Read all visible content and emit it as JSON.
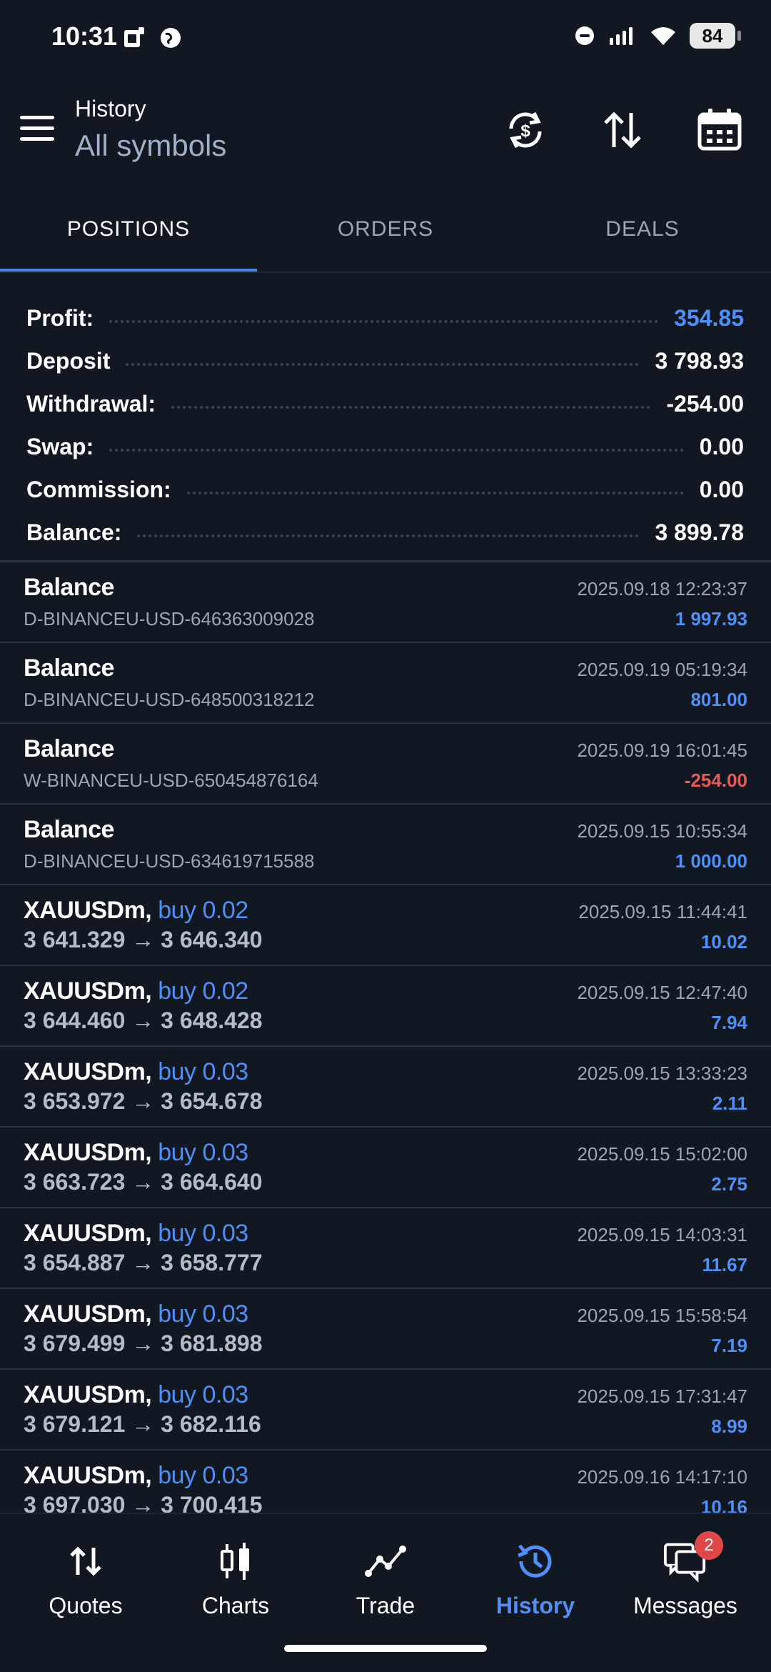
{
  "status_bar": {
    "time": "10:31",
    "battery": "84"
  },
  "header": {
    "title": "History",
    "subtitle": "All symbols"
  },
  "tabs": [
    {
      "label": "POSITIONS",
      "active": true
    },
    {
      "label": "ORDERS",
      "active": false
    },
    {
      "label": "DEALS",
      "active": false
    }
  ],
  "summary": [
    {
      "label": "Profit:",
      "value": "354.85",
      "highlight": true
    },
    {
      "label": "Deposit",
      "value": "3 798.93"
    },
    {
      "label": "Withdrawal:",
      "value": "-254.00"
    },
    {
      "label": "Swap:",
      "value": "0.00"
    },
    {
      "label": "Commission:",
      "value": "0.00"
    },
    {
      "label": "Balance:",
      "value": "3 899.78"
    }
  ],
  "balance_rows": [
    {
      "title": "Balance",
      "sub": "D-BINANCEU-USD-646363009028",
      "time": "2025.09.18 12:23:37",
      "amount": "1 997.93"
    },
    {
      "title": "Balance",
      "sub": "D-BINANCEU-USD-648500318212",
      "time": "2025.09.19 05:19:34",
      "amount": "801.00"
    },
    {
      "title": "Balance",
      "sub": "W-BINANCEU-USD-650454876164",
      "time": "2025.09.19 16:01:45",
      "amount": "-254.00"
    },
    {
      "title": "Balance",
      "sub": "D-BINANCEU-USD-634619715588",
      "time": "2025.09.15 10:55:34",
      "amount": "1 000.00"
    }
  ],
  "trade_rows": [
    {
      "symbol": "XAUUSDm,",
      "side": "buy 0.02",
      "prices": "3 641.329 → 3 646.340",
      "time": "2025.09.15 11:44:41",
      "amount": "10.02"
    },
    {
      "symbol": "XAUUSDm,",
      "side": "buy 0.02",
      "prices": "3 644.460 → 3 648.428",
      "time": "2025.09.15 12:47:40",
      "amount": "7.94"
    },
    {
      "symbol": "XAUUSDm,",
      "side": "buy 0.03",
      "prices": "3 653.972 → 3 654.678",
      "time": "2025.09.15 13:33:23",
      "amount": "2.11"
    },
    {
      "symbol": "XAUUSDm,",
      "side": "buy 0.03",
      "prices": "3 663.723 → 3 664.640",
      "time": "2025.09.15 15:02:00",
      "amount": "2.75"
    },
    {
      "symbol": "XAUUSDm,",
      "side": "buy 0.03",
      "prices": "3 654.887 → 3 658.777",
      "time": "2025.09.15 14:03:31",
      "amount": "11.67"
    },
    {
      "symbol": "XAUUSDm,",
      "side": "buy 0.03",
      "prices": "3 679.499 → 3 681.898",
      "time": "2025.09.15 15:58:54",
      "amount": "7.19"
    },
    {
      "symbol": "XAUUSDm,",
      "side": "buy 0.03",
      "prices": "3 679.121 → 3 682.116",
      "time": "2025.09.15 17:31:47",
      "amount": "8.99"
    },
    {
      "symbol": "XAUUSDm,",
      "side": "buy 0.03",
      "prices": "3 697.030 → 3 700.415",
      "time": "2025.09.16 14:17:10",
      "amount": "10.16"
    }
  ],
  "bottom_nav": [
    {
      "label": "Quotes",
      "icon": "quotes-icon"
    },
    {
      "label": "Charts",
      "icon": "charts-icon"
    },
    {
      "label": "Trade",
      "icon": "trade-icon"
    },
    {
      "label": "History",
      "icon": "history-icon",
      "active": true
    },
    {
      "label": "Messages",
      "icon": "messages-icon",
      "badge": "2"
    }
  ],
  "colors": {
    "background": "#121822",
    "accent": "#4f8ff7",
    "negative": "#e85a5a",
    "muted": "#9aa6b6"
  }
}
